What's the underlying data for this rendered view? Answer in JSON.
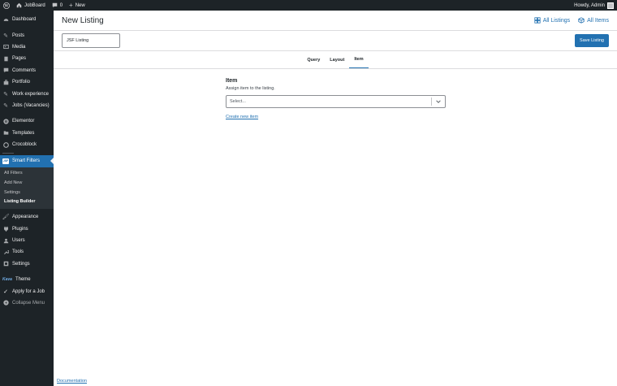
{
  "admin_bar": {
    "site_name": "JobBoard",
    "comment_count": "0",
    "new_label": "New",
    "greeting": "Howdy, Admin"
  },
  "sidebar": {
    "items": [
      {
        "label": "Dashboard",
        "icon": "dashboard-icon"
      },
      {
        "label": "Posts",
        "icon": "pin-icon"
      },
      {
        "label": "Media",
        "icon": "media-icon"
      },
      {
        "label": "Pages",
        "icon": "pages-icon"
      },
      {
        "label": "Comments",
        "icon": "comment-icon"
      },
      {
        "label": "Portfolio",
        "icon": "portfolio-icon"
      },
      {
        "label": "Work experience",
        "icon": "pin-icon"
      },
      {
        "label": "Jobs (Vacancies)",
        "icon": "pin-icon"
      },
      {
        "label": "Elementor",
        "icon": "elementor-icon"
      },
      {
        "label": "Templates",
        "icon": "folder-icon"
      },
      {
        "label": "Crocoblock",
        "icon": "crocoblock-icon"
      },
      {
        "label": "Smart Filters",
        "icon": "jsf-icon"
      },
      {
        "label": "Appearance",
        "icon": "brush-icon"
      },
      {
        "label": "Plugins",
        "icon": "plug-icon"
      },
      {
        "label": "Users",
        "icon": "user-icon"
      },
      {
        "label": "Tools",
        "icon": "wrench-icon"
      },
      {
        "label": "Settings",
        "icon": "settings-icon"
      },
      {
        "label": "Theme",
        "icon": "theme-logo-icon"
      },
      {
        "label": "Apply for a Job",
        "icon": "check-icon"
      },
      {
        "label": "Collapse Menu",
        "icon": "collapse-icon"
      }
    ],
    "submenu": [
      "All Filters",
      "Add New",
      "Settings",
      "Listing Builder"
    ],
    "theme_logo": "Kava"
  },
  "header": {
    "title": "New Listing",
    "links": [
      {
        "label": "All Listings",
        "icon": "grid-icon"
      },
      {
        "label": "All Items",
        "icon": "cube-icon"
      }
    ]
  },
  "toolbar": {
    "listing_name": "JSF Listing",
    "save_label": "Save Listing"
  },
  "tabs": [
    {
      "label": "Query",
      "active": false
    },
    {
      "label": "Layout",
      "active": false
    },
    {
      "label": "Item",
      "active": true
    }
  ],
  "panel": {
    "title": "Item",
    "description": "Assign item to the listing.",
    "select_placeholder": "Select...",
    "create_link": "Create new item"
  },
  "footer": {
    "documentation": "Documentation"
  },
  "colors": {
    "accent": "#2271b1",
    "admin_dark": "#1d2327"
  }
}
